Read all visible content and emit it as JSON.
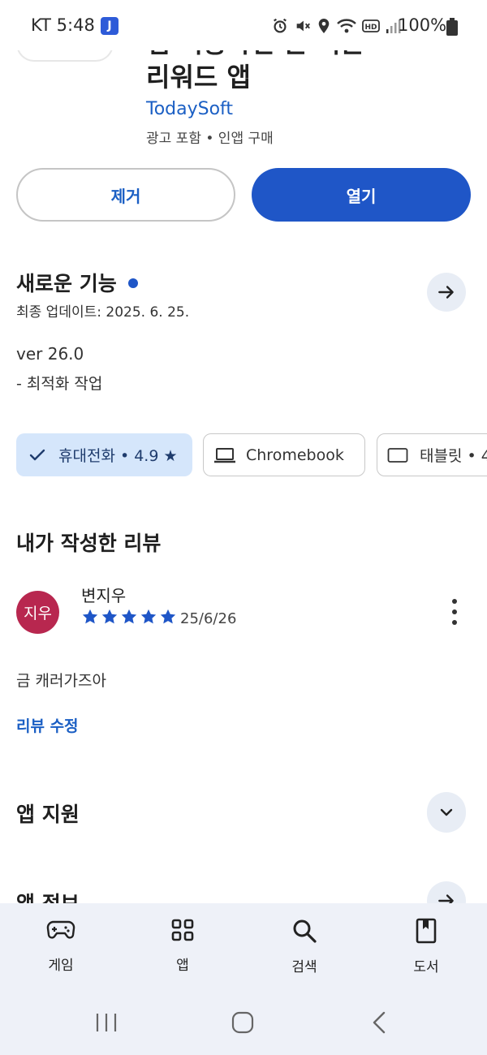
{
  "status_bar": {
    "carrier_time": "KT 5:48",
    "app_badge": "J",
    "battery": "100%",
    "icons": [
      "alarm-icon",
      "mute-icon",
      "location-icon",
      "wifi-icon",
      "hd-icon",
      "signal-icon",
      "battery-icon"
    ]
  },
  "app": {
    "title_line1": "앱 이용하면 돈 버는",
    "title_line2": "리워드 앱",
    "developer": "TodaySoft",
    "meta": "광고 포함 • 인앱 구매"
  },
  "actions": {
    "uninstall": "제거",
    "open": "열기"
  },
  "whats_new": {
    "title": "새로운 기능",
    "updated": "최종 업데이트: 2025. 6. 25.",
    "version": "ver 26.0",
    "notes": "- 최적화 작업"
  },
  "device_chips": [
    {
      "label": "휴대전화 • 4.9 ★",
      "selected": true
    },
    {
      "label": "Chromebook",
      "selected": false
    },
    {
      "label": "태블릿 • 4",
      "selected": false
    }
  ],
  "my_review": {
    "title": "내가 작성한 리뷰",
    "avatar_text": "지우",
    "reviewer": "변지우",
    "rating": 5,
    "date": "25/6/26",
    "text": "금 캐러가즈아",
    "edit_label": "리뷰 수정"
  },
  "sections": {
    "app_support": "앱 지원",
    "app_info": "앱 정보"
  },
  "bottom_nav": [
    {
      "label": "게임",
      "icon": "gamepad-icon"
    },
    {
      "label": "앱",
      "icon": "apps-grid-icon"
    },
    {
      "label": "검색",
      "icon": "search-icon"
    },
    {
      "label": "도서",
      "icon": "book-icon"
    }
  ],
  "colors": {
    "accent": "#1f56c7",
    "link": "#1b5fc4",
    "chip_selected": "#d5e6fb",
    "avatar": "#b8274f",
    "nav_background": "#eef1f8"
  }
}
